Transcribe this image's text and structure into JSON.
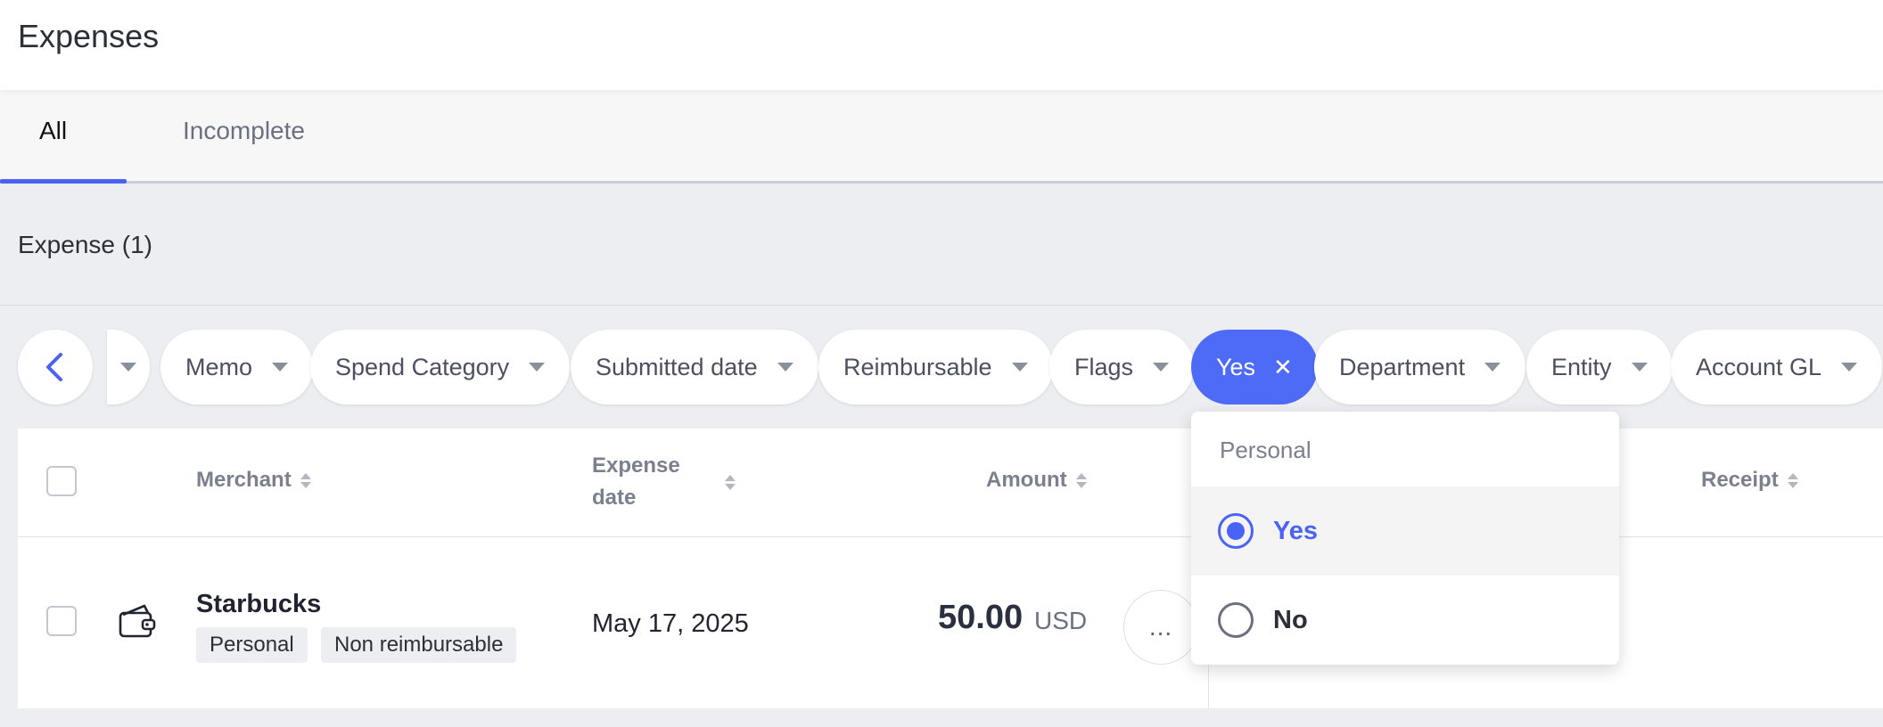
{
  "header": {
    "title": "Expenses"
  },
  "tabs": [
    {
      "label": "All",
      "active": true
    },
    {
      "label": "Incomplete",
      "active": false
    }
  ],
  "section": {
    "title": "Expense (1)"
  },
  "filters": {
    "items": [
      {
        "label": "Memo"
      },
      {
        "label": "Spend Category"
      },
      {
        "label": "Submitted date"
      },
      {
        "label": "Reimbursable"
      },
      {
        "label": "Flags"
      },
      {
        "label": "Yes",
        "active": true
      },
      {
        "label": "Department"
      },
      {
        "label": "Entity"
      },
      {
        "label": "Account GL"
      }
    ],
    "icons": {
      "back": "chevron-left-icon",
      "dropdown": "caret-down-icon",
      "clear": "close-icon"
    },
    "accent": "#4d6bf6"
  },
  "table": {
    "columns": {
      "merchant": "Merchant",
      "expense_date_line1": "Expense",
      "expense_date_line2": "date",
      "amount": "Amount",
      "receipt": "Receipt"
    },
    "rows": [
      {
        "merchant": "Starbucks",
        "icon": "wallet-icon",
        "tags": [
          "Personal",
          "Non reimbursable"
        ],
        "date": "May 17, 2025",
        "amount": "50.00",
        "currency": "USD",
        "more": "..."
      }
    ]
  },
  "dropdown": {
    "header": "Personal",
    "options": [
      {
        "label": "Yes",
        "selected": true
      },
      {
        "label": "No",
        "selected": false
      }
    ]
  }
}
